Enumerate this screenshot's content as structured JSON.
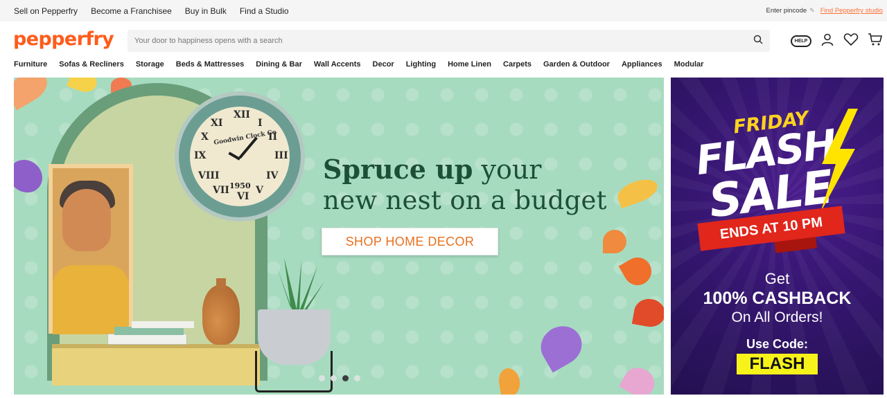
{
  "topbar": {
    "links": [
      "Sell on Pepperfry",
      "Become a Franchisee",
      "Buy in Bulk",
      "Find a Studio"
    ],
    "pincode_label": "Enter pincode",
    "studio_link": "Find Pepperfry studio"
  },
  "header": {
    "logo": "pepperfry",
    "search_placeholder": "Your door to happiness opens with a search",
    "help_label": "HELP",
    "icons": [
      "search-icon",
      "help-icon",
      "user-icon",
      "heart-icon",
      "cart-icon"
    ],
    "brand_color": "#ff5b1a"
  },
  "nav": {
    "items": [
      "Furniture",
      "Sofas & Recliners",
      "Storage",
      "Beds & Mattresses",
      "Dining & Bar",
      "Wall Accents",
      "Decor",
      "Lighting",
      "Home Linen",
      "Carpets",
      "Garden & Outdoor",
      "Appliances",
      "Modular"
    ]
  },
  "hero": {
    "headline_bold": "Spruce up",
    "headline_rest": " your",
    "headline_line2": "new nest on a budget",
    "cta_label": "SHOP HOME DECOR",
    "clock_brand": "Goodwin Clock Co",
    "clock_year": "1950",
    "slides_total": 4,
    "active_slide": 3,
    "bg_color": "#a7dbc0"
  },
  "flash_sale": {
    "friday": "FRIDAY",
    "flash_word": "FLASH",
    "sale_word": "SALE",
    "ribbon": "ENDS AT 10 PM",
    "get": "Get",
    "cashback": "100% CASHBACK",
    "orders": "On All Orders!",
    "use_code": "Use Code:",
    "code": "FLASH",
    "bg_color": "#351670",
    "accent_color": "#ffd21f"
  }
}
